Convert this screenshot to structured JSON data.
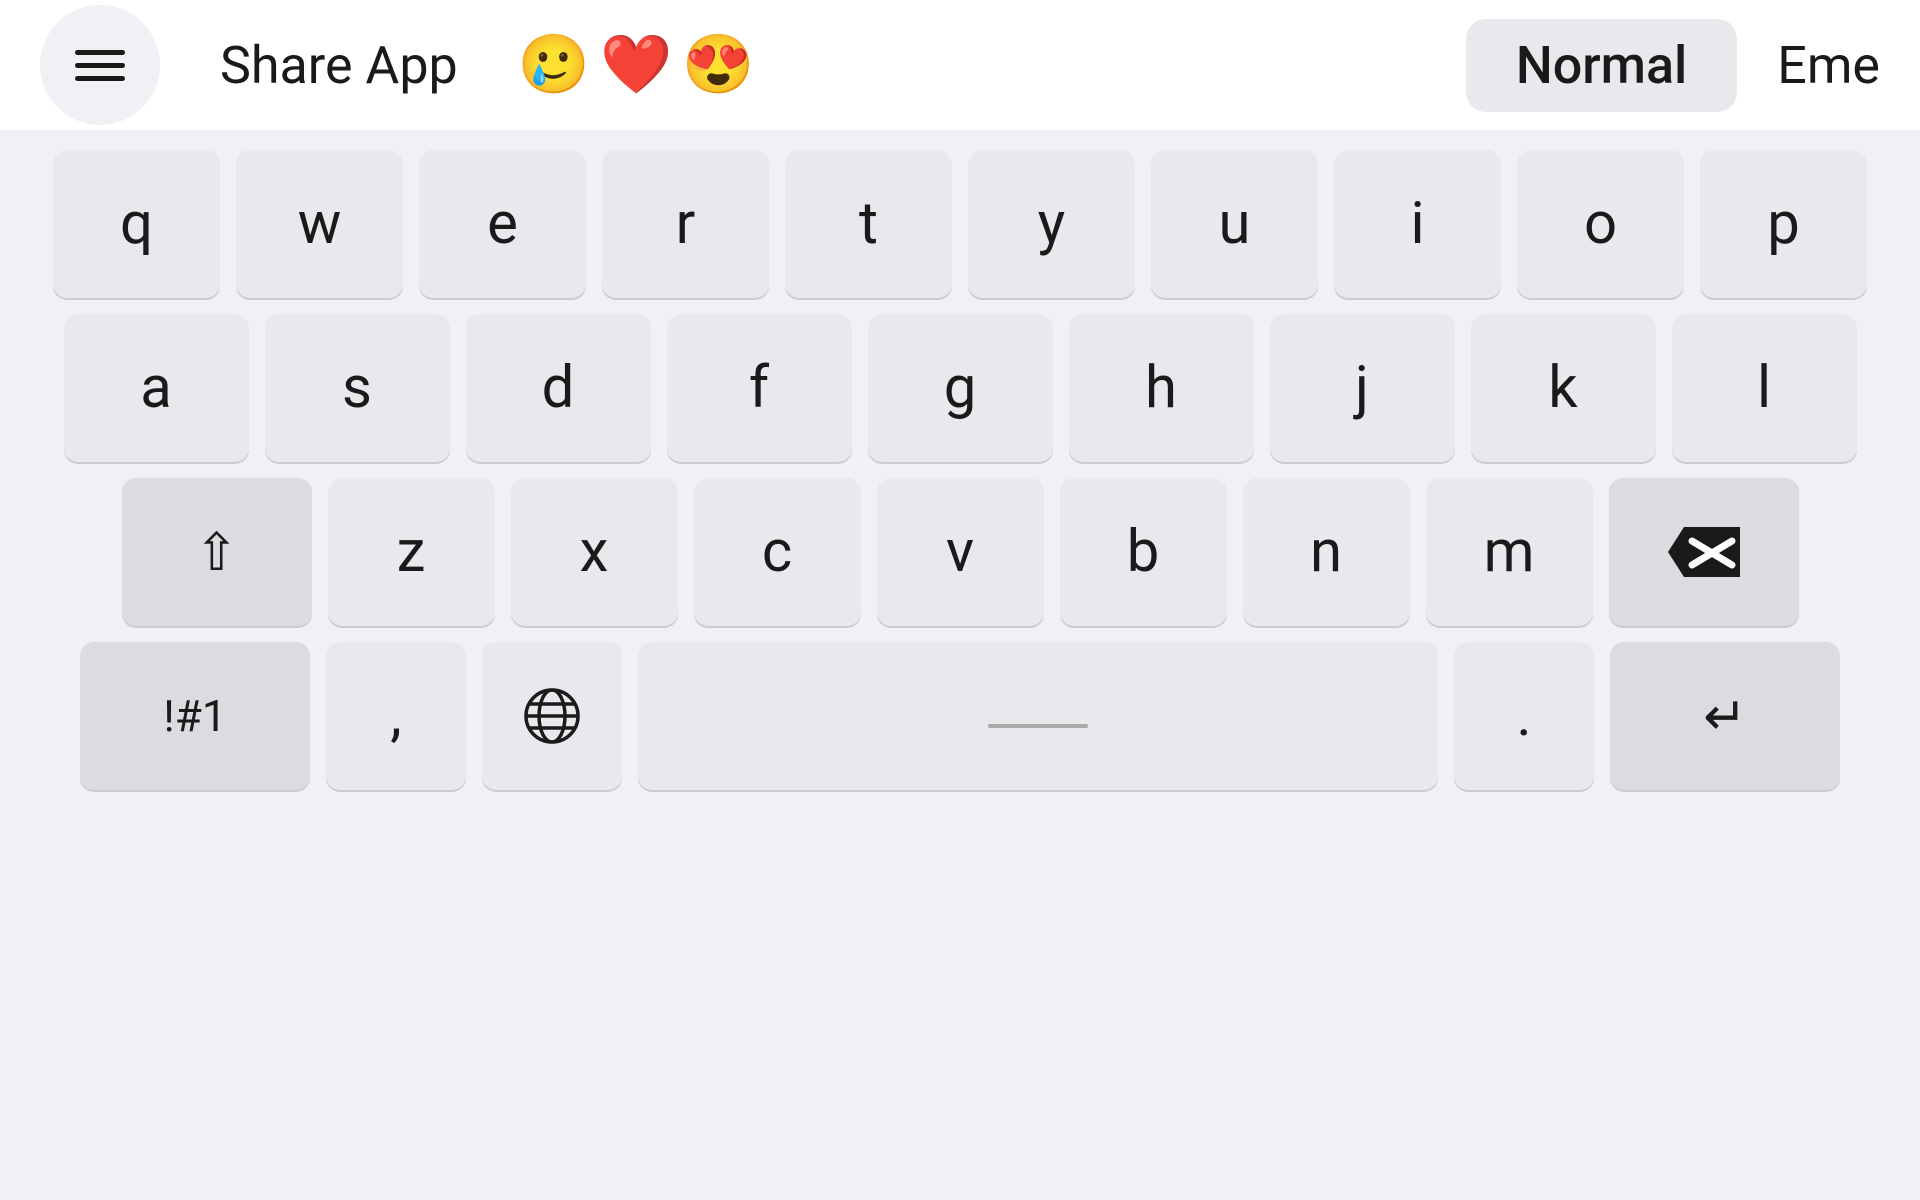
{
  "topbar": {
    "menu_label": "menu",
    "share_app": "Share App",
    "emojis": "🥲❤️😍",
    "normal_label": "Normal",
    "emo_label": "Eme"
  },
  "keyboard": {
    "row1": [
      "q",
      "w",
      "e",
      "r",
      "t",
      "y",
      "u",
      "i",
      "o",
      "p"
    ],
    "row2": [
      "a",
      "s",
      "d",
      "f",
      "g",
      "h",
      "j",
      "k",
      "l"
    ],
    "row3": [
      "z",
      "x",
      "c",
      "v",
      "b",
      "n",
      "m"
    ],
    "shift_label": "⇧",
    "num_label": "!#1",
    "comma_label": ",",
    "globe_label": "🌐",
    "space_label": "",
    "period_label": ".",
    "enter_label": "↵"
  }
}
